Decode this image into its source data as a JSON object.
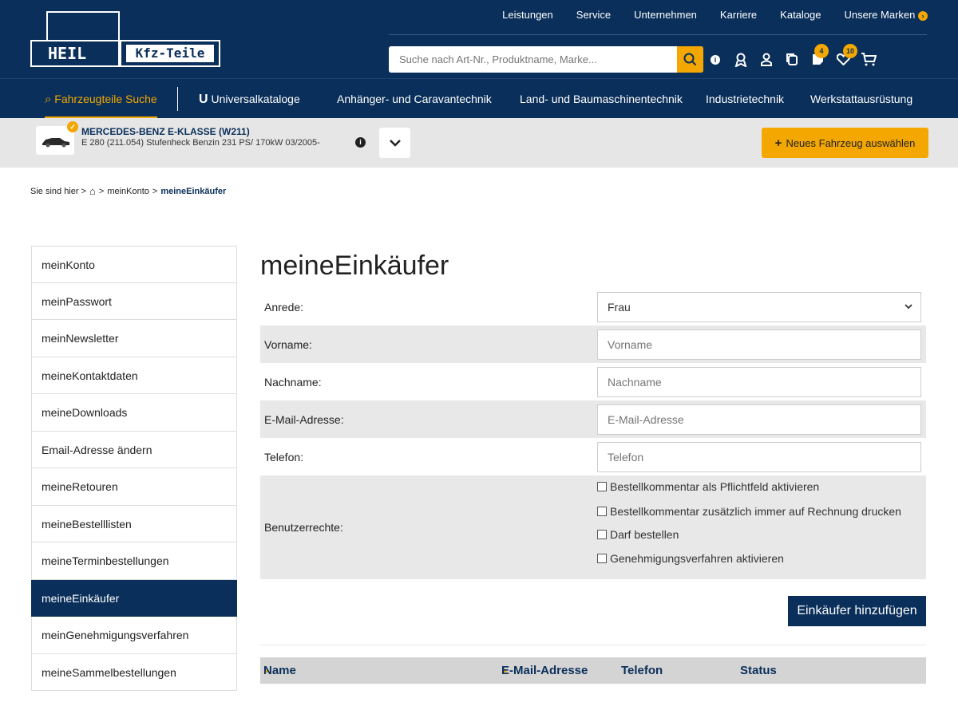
{
  "brand": {
    "logo_left": "HEIL",
    "logo_right": "Kfz-Teile"
  },
  "top_nav": [
    "Leistungen",
    "Service",
    "Unternehmen",
    "Karriere",
    "Kataloge",
    "Unsere Marken"
  ],
  "search": {
    "placeholder": "Suche nach Art-Nr., Produktname, Marke..."
  },
  "header_icons": {
    "info": "info-icon",
    "award": "award-icon",
    "user": "user-icon",
    "copy": "copy-icon",
    "notes_badge": "4",
    "wishlist_badge": "10",
    "cart": "cart-icon"
  },
  "categories": [
    "Fahrzeugteile Suche",
    "Universalkataloge",
    "Anhänger- und Caravantechnik",
    "Land- und Baumaschinentechnik",
    "Industrietechnik",
    "Werkstattausrüstung"
  ],
  "vehicle": {
    "title": "MERCEDES-BENZ E-KLASSE (W211)",
    "details": "E 280 (211.054) Stufenheck Benzin 231 PS/ 170kW 03/2005-",
    "new_button": "Neues Fahrzeug auswählen"
  },
  "breadcrumb": {
    "prefix": "Sie sind hier >",
    "sep": ">",
    "account": "meinKonto",
    "current": "meineEinkäufer"
  },
  "sidebar": [
    "meinKonto",
    "meinPasswort",
    "meinNewsletter",
    "meineKontaktdaten",
    "meineDownloads",
    "Email-Adresse ändern",
    "meineRetouren",
    "meineBestelllisten",
    "meineTerminbestellungen",
    "meineEinkäufer",
    "meinGenehmigungsverfahren",
    "meineSammelbestellungen"
  ],
  "page_title": "meineEinkäufer",
  "form": {
    "salutation_label": "Anrede:",
    "salutation_value": "Frau",
    "firstname_label": "Vorname:",
    "firstname_placeholder": "Vorname",
    "lastname_label": "Nachname:",
    "lastname_placeholder": "Nachname",
    "email_label": "E-Mail-Adresse:",
    "email_placeholder": "E-Mail-Adresse",
    "phone_label": "Telefon:",
    "phone_placeholder": "Telefon",
    "rights_label": "Benutzerrechte:",
    "rights": [
      "Bestellkommentar als Pflichtfeld aktivieren",
      "Bestellkommentar zusätzlich immer auf Rechnung drucken",
      "Darf bestellen",
      "Genehmigungsverfahren aktivieren"
    ],
    "submit": "Einkäufer hinzufügen"
  },
  "table": {
    "columns": [
      "Name",
      "E-Mail-Adresse",
      "Telefon",
      "Status"
    ]
  },
  "colors": {
    "navy": "#0a2f5a",
    "accent": "#f4a700"
  }
}
